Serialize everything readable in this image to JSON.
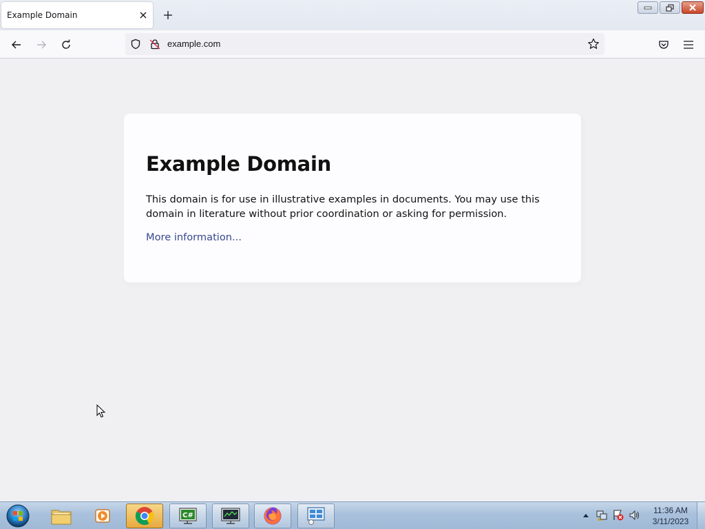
{
  "browser": {
    "tab": {
      "title": "Example Domain"
    },
    "url": "example.com"
  },
  "page": {
    "heading": "Example Domain",
    "description": "This domain is for use in illustrative examples in documents. You may use this domain in literature without prior coordination or asking for permission.",
    "link_text": "More information..."
  },
  "taskbar": {
    "pinned": [
      {
        "name": "windows-explorer",
        "icon": "folder-icon"
      },
      {
        "name": "media-player",
        "icon": "media-player-icon"
      },
      {
        "name": "chrome",
        "icon": "chrome-icon"
      },
      {
        "name": "csharp-ide",
        "icon": "csharp-icon"
      },
      {
        "name": "task-manager",
        "icon": "monitor-icon"
      },
      {
        "name": "firefox",
        "icon": "firefox-icon"
      },
      {
        "name": "control-panel",
        "icon": "control-panel-icon"
      }
    ],
    "time": "11:36 AM",
    "date": "3/11/2023"
  },
  "colors": {
    "link": "#38488f",
    "page_background": "#f0f0f2",
    "card_background": "#fdfdff",
    "close_button": "#c9452a"
  }
}
